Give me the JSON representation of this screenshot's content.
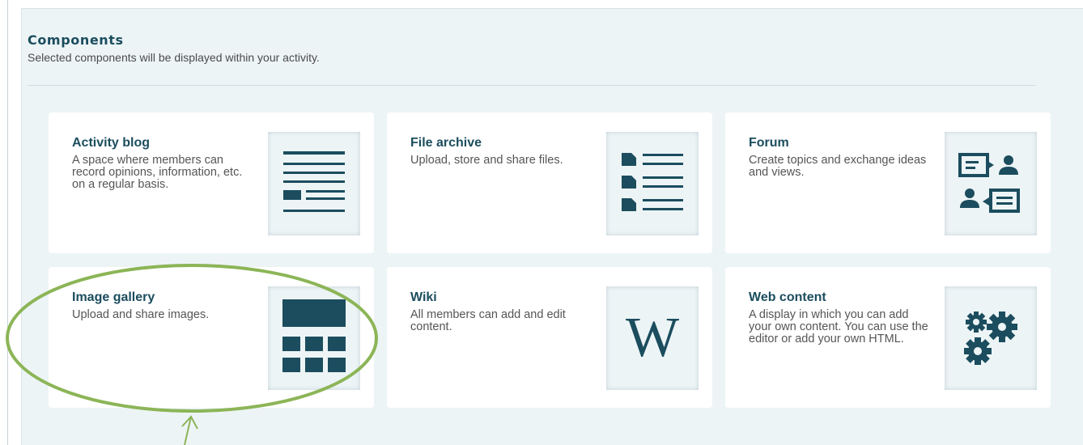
{
  "section": {
    "title": "Components",
    "subtitle": "Selected components will be displayed within your activity."
  },
  "components": [
    {
      "title": "Activity blog",
      "description": "A space where members can record opinions, information, etc. on a regular basis.",
      "icon": "blog-icon"
    },
    {
      "title": "File archive",
      "description": "Upload, store and share files.",
      "icon": "file-archive-icon"
    },
    {
      "title": "Forum",
      "description": "Create topics and exchange ideas and views.",
      "icon": "forum-icon"
    },
    {
      "title": "Image gallery",
      "description": "Upload and share images.",
      "icon": "image-gallery-icon"
    },
    {
      "title": "Wiki",
      "description": "All members can add and edit content.",
      "icon": "wiki-icon",
      "glyph": "W"
    },
    {
      "title": "Web content",
      "description": "A display in which you can add your own content. You can use the editor or add your own HTML.",
      "icon": "gears-icon"
    }
  ],
  "colors": {
    "icon": "#1b4d5e",
    "annotation": "#8cb557",
    "panel_bg": "#edf4f6"
  }
}
